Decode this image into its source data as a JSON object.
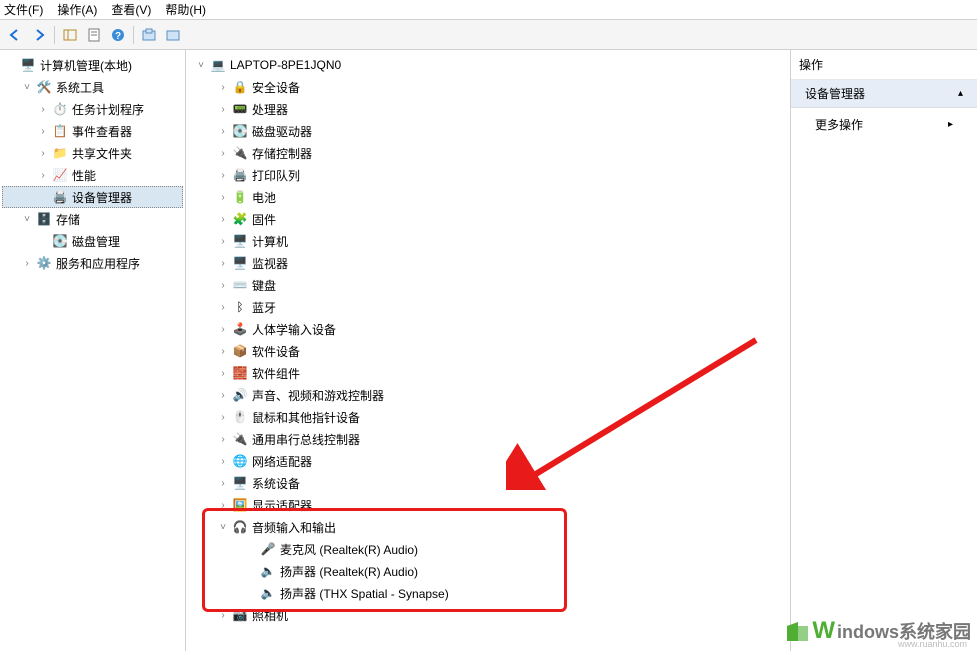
{
  "menu": {
    "file": "文件(F)",
    "action": "操作(A)",
    "view": "查看(V)",
    "help": "帮助(H)"
  },
  "left_tree": {
    "root": "计算机管理(本地)",
    "sys_tools": "系统工具",
    "task_scheduler": "任务计划程序",
    "event_viewer": "事件查看器",
    "shared_folders": "共享文件夹",
    "performance": "性能",
    "device_manager": "设备管理器",
    "storage": "存储",
    "disk_management": "磁盘管理",
    "services_apps": "服务和应用程序"
  },
  "devices": {
    "root": "LAPTOP-8PE1JQN0",
    "security": "安全设备",
    "processor": "处理器",
    "disk_drives": "磁盘驱动器",
    "storage_ctrl": "存储控制器",
    "print_queues": "打印队列",
    "batteries": "电池",
    "firmware": "固件",
    "computer": "计算机",
    "monitors": "监视器",
    "keyboards": "键盘",
    "bluetooth": "蓝牙",
    "hid": "人体学输入设备",
    "sw_devices": "软件设备",
    "sw_components": "软件组件",
    "sound_video_game": "声音、视频和游戏控制器",
    "mice": "鼠标和其他指针设备",
    "usb_ctrl": "通用串行总线控制器",
    "net_adapters": "网络适配器",
    "sys_devices": "系统设备",
    "display_adapters": "显示适配器",
    "audio_io": "音频输入和输出",
    "mic_realtek": "麦克风 (Realtek(R) Audio)",
    "speaker_realtek": "扬声器 (Realtek(R) Audio)",
    "speaker_thx": "扬声器 (THX Spatial - Synapse)",
    "cameras": "照相机"
  },
  "right_panel": {
    "header": "操作",
    "title": "设备管理器",
    "more_actions": "更多操作"
  },
  "watermark": {
    "main": "indows系统家园",
    "prefix": "W",
    "sub": "www.ruanhu.com"
  }
}
